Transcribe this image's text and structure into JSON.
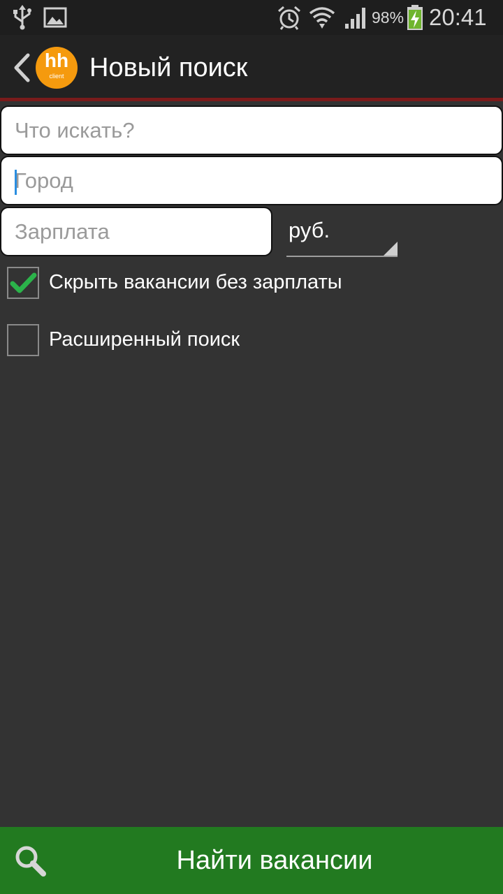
{
  "status_bar": {
    "battery": "98%",
    "time": "20:41",
    "icons": [
      "usb-icon",
      "image-icon",
      "alarm-icon",
      "wifi-icon",
      "signal-icon",
      "battery-charging-icon"
    ]
  },
  "header": {
    "title": "Новый поиск",
    "logo_text": "hh",
    "logo_sub": "client"
  },
  "form": {
    "query_placeholder": "Что искать?",
    "city_placeholder": "Город",
    "salary_placeholder": "Зарплата",
    "currency": "руб.",
    "hide_without_salary_label": "Скрыть вакансии без зарплаты",
    "hide_without_salary_checked": true,
    "advanced_search_label": "Расширенный поиск",
    "advanced_search_checked": false
  },
  "footer": {
    "search_button_label": "Найти вакансии"
  },
  "colors": {
    "background": "#333333",
    "action_bar": "#222222",
    "accent_line": "#7a1b1b",
    "primary_button": "#227a20",
    "checkmark": "#2bb34a",
    "logo": "#f59a0e"
  }
}
